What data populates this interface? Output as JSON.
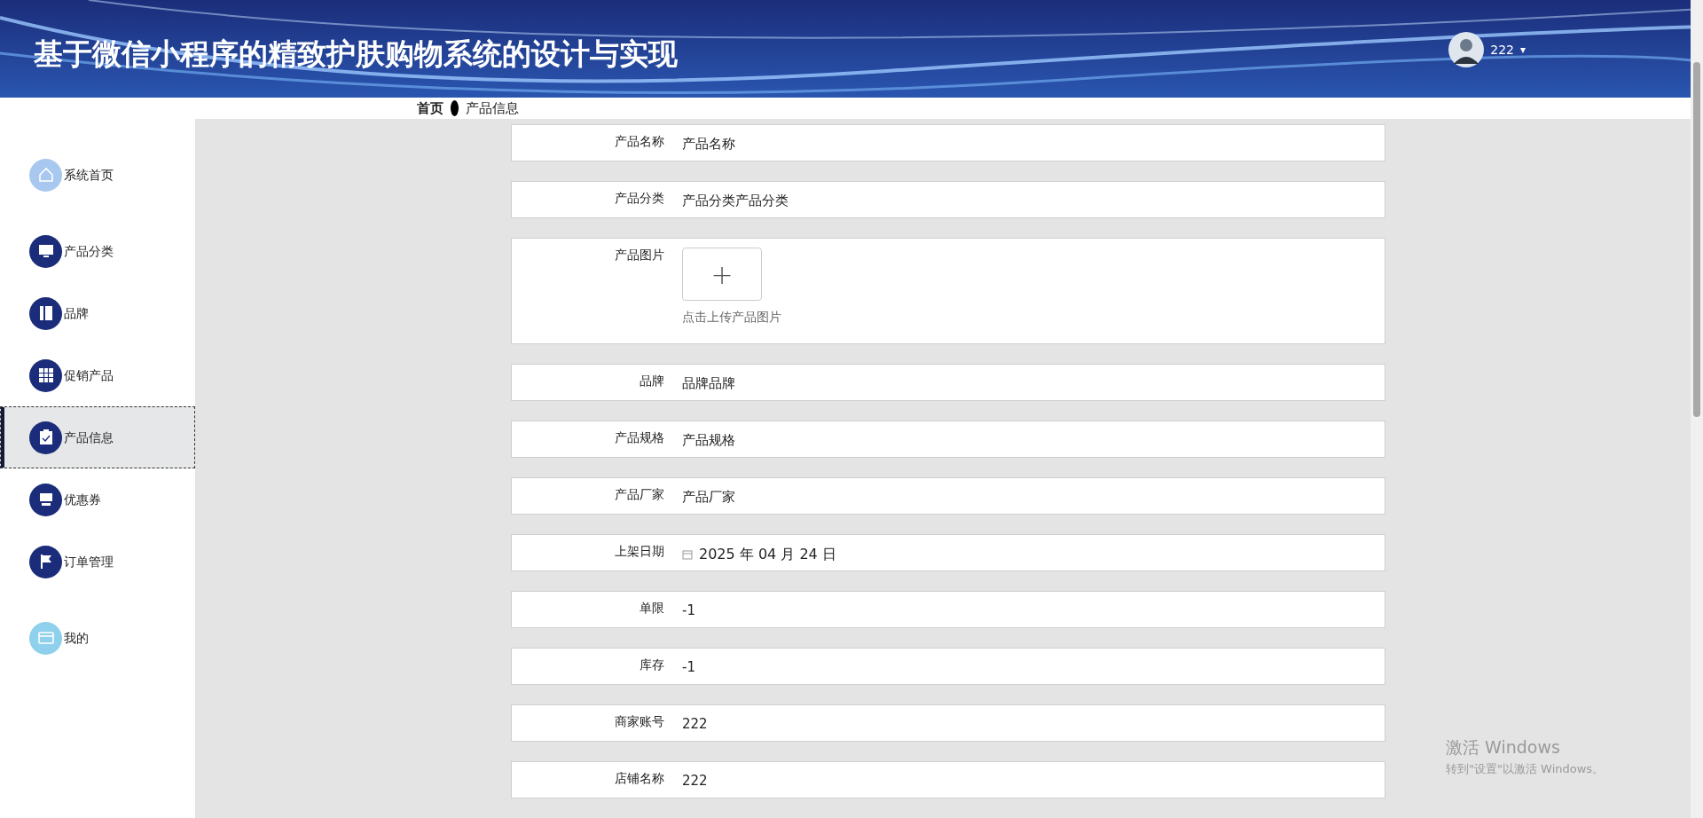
{
  "header": {
    "title": "基于微信小程序的精致护肤购物系统的设计与实现",
    "user": "222",
    "caret": "▾"
  },
  "sidebar": {
    "items": [
      {
        "label": "系统首页",
        "selected": false
      },
      {
        "label": "产品分类",
        "selected": false
      },
      {
        "label": "品牌",
        "selected": false
      },
      {
        "label": "促销产品",
        "selected": false
      },
      {
        "label": "产品信息",
        "selected": true
      },
      {
        "label": "优惠券",
        "selected": false
      },
      {
        "label": "订单管理",
        "selected": false
      },
      {
        "label": "我的",
        "selected": false
      }
    ]
  },
  "breadcrumb": [
    "首页",
    "产品信息"
  ],
  "form": {
    "fields": [
      {
        "kind": "text",
        "label": "产品名称",
        "value": "产品名称"
      },
      {
        "kind": "text",
        "label": "产品分类",
        "value": "产品分类产品分类"
      },
      {
        "kind": "upload",
        "label": "产品图片",
        "hint": "点击上传产品图片",
        "plus": "+"
      },
      {
        "kind": "text",
        "label": "品牌",
        "value": "品牌品牌"
      },
      {
        "kind": "text",
        "label": "产品规格",
        "value": "产品规格"
      },
      {
        "kind": "text",
        "label": "产品厂家",
        "value": "产品厂家"
      },
      {
        "kind": "date",
        "label": "上架日期",
        "value": "2025 年 04 月 24 日"
      },
      {
        "kind": "text",
        "label": "单限",
        "value": "-1"
      },
      {
        "kind": "text",
        "label": "库存",
        "value": "-1"
      },
      {
        "kind": "text",
        "label": "商家账号",
        "value": "222"
      },
      {
        "kind": "text",
        "label": "店铺名称",
        "value": "222"
      }
    ]
  },
  "os_notice": {
    "title": "激活 Windows",
    "subtitle": "转到\"设置\"以激活 Windows。"
  }
}
